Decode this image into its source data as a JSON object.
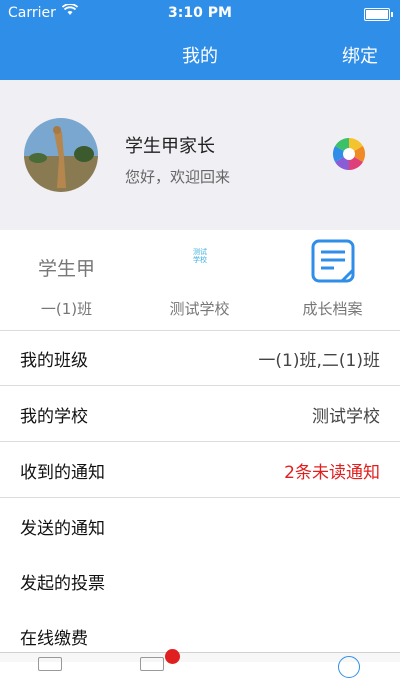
{
  "status_bar": {
    "carrier": "Carrier",
    "time": "3:10 PM"
  },
  "nav": {
    "title": "我的",
    "bind_label": "绑定"
  },
  "profile": {
    "name": "学生甲家长",
    "welcome": "您好，欢迎回来"
  },
  "stats": [
    {
      "top": "学生甲",
      "bottom": "一(1)班"
    },
    {
      "icon_text": [
        "测试",
        "学校"
      ],
      "bottom": "测试学校"
    },
    {
      "icon": "document-icon",
      "bottom": "成长档案"
    }
  ],
  "menu": [
    {
      "label": "我的班级",
      "value": "一(1)班,二(1)班"
    },
    {
      "label": "我的学校",
      "value": "测试学校"
    },
    {
      "label": "收到的通知",
      "value": "2条未读通知",
      "value_color": "#e02020"
    },
    {
      "label": "发送的通知",
      "value": ""
    },
    {
      "label": "发起的投票",
      "value": ""
    },
    {
      "label": "在线缴费",
      "value": ""
    }
  ],
  "colors": {
    "accent": "#2f8ee8",
    "profile_bg": "#efeff4",
    "alert": "#e02020"
  }
}
